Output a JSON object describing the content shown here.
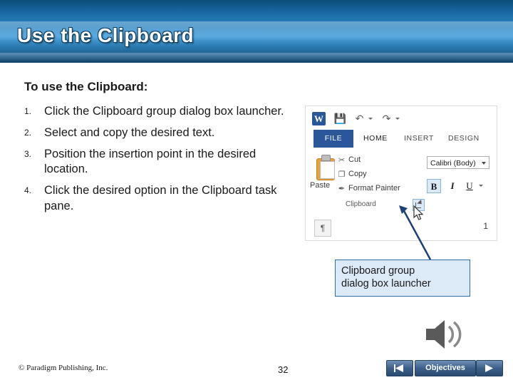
{
  "slide": {
    "title": "Use the Clipboard",
    "lead": "To use the Clipboard:",
    "steps": [
      {
        "num": "1.",
        "text": "Click the Clipboard group dialog box launcher."
      },
      {
        "num": "2.",
        "text": "Select and copy the desired text."
      },
      {
        "num": "3.",
        "text": "Position the insertion point in the desired location."
      },
      {
        "num": "4.",
        "text": "Click the desired option in the Clipboard task pane."
      }
    ]
  },
  "callout": {
    "line1": "Clipboard group",
    "line2": "dialog box launcher"
  },
  "word_screenshot": {
    "app_logo": "W",
    "quick_access": {
      "save_icon": "save-icon",
      "undo_icon": "undo-icon",
      "redo_icon": "redo-icon"
    },
    "tabs": [
      {
        "label": "FILE",
        "active": true
      },
      {
        "label": "HOME",
        "active": false
      },
      {
        "label": "INSERT",
        "active": false
      },
      {
        "label": "DESIGN",
        "active": false
      }
    ],
    "clipboard_group": {
      "paste_label": "Paste",
      "cut_label": "Cut",
      "copy_label": "Copy",
      "format_painter_label": "Format Painter",
      "group_name": "Clipboard",
      "launcher_name": "dialog-box-launcher"
    },
    "font_group": {
      "font_name": "Calibri (Body)",
      "bold": "B",
      "italic": "I",
      "underline": "U"
    },
    "document": {
      "pilcrow": "¶",
      "page_number": "1"
    }
  },
  "footer": {
    "copyright": "© Paradigm Publishing, Inc.",
    "page_number": "32",
    "objectives_label": "Objectives",
    "prev_icon": "previous-triangle-icon",
    "next_icon": "next-triangle-icon",
    "speaker_icon": "speaker-icon"
  },
  "colors": {
    "banner_dark": "#0d4d7a",
    "banner_light": "#4ea4dd",
    "callout_fill": "#dce9f6",
    "callout_border": "#2e6da4",
    "word_blue": "#2b579a",
    "nav_button": "#3c5f8a"
  }
}
